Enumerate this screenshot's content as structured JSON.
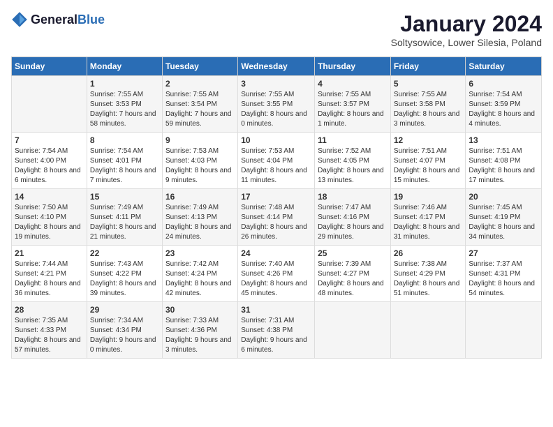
{
  "header": {
    "logo_general": "General",
    "logo_blue": "Blue",
    "month_title": "January 2024",
    "location": "Soltysowice, Lower Silesia, Poland"
  },
  "days_of_week": [
    "Sunday",
    "Monday",
    "Tuesday",
    "Wednesday",
    "Thursday",
    "Friday",
    "Saturday"
  ],
  "weeks": [
    [
      {
        "day": "",
        "info": ""
      },
      {
        "day": "1",
        "info": "Sunrise: 7:55 AM\nSunset: 3:53 PM\nDaylight: 7 hours\nand 58 minutes."
      },
      {
        "day": "2",
        "info": "Sunrise: 7:55 AM\nSunset: 3:54 PM\nDaylight: 7 hours\nand 59 minutes."
      },
      {
        "day": "3",
        "info": "Sunrise: 7:55 AM\nSunset: 3:55 PM\nDaylight: 8 hours\nand 0 minutes."
      },
      {
        "day": "4",
        "info": "Sunrise: 7:55 AM\nSunset: 3:57 PM\nDaylight: 8 hours\nand 1 minute."
      },
      {
        "day": "5",
        "info": "Sunrise: 7:55 AM\nSunset: 3:58 PM\nDaylight: 8 hours\nand 3 minutes."
      },
      {
        "day": "6",
        "info": "Sunrise: 7:54 AM\nSunset: 3:59 PM\nDaylight: 8 hours\nand 4 minutes."
      }
    ],
    [
      {
        "day": "7",
        "info": "Sunrise: 7:54 AM\nSunset: 4:00 PM\nDaylight: 8 hours\nand 6 minutes."
      },
      {
        "day": "8",
        "info": "Sunrise: 7:54 AM\nSunset: 4:01 PM\nDaylight: 8 hours\nand 7 minutes."
      },
      {
        "day": "9",
        "info": "Sunrise: 7:53 AM\nSunset: 4:03 PM\nDaylight: 8 hours\nand 9 minutes."
      },
      {
        "day": "10",
        "info": "Sunrise: 7:53 AM\nSunset: 4:04 PM\nDaylight: 8 hours\nand 11 minutes."
      },
      {
        "day": "11",
        "info": "Sunrise: 7:52 AM\nSunset: 4:05 PM\nDaylight: 8 hours\nand 13 minutes."
      },
      {
        "day": "12",
        "info": "Sunrise: 7:51 AM\nSunset: 4:07 PM\nDaylight: 8 hours\nand 15 minutes."
      },
      {
        "day": "13",
        "info": "Sunrise: 7:51 AM\nSunset: 4:08 PM\nDaylight: 8 hours\nand 17 minutes."
      }
    ],
    [
      {
        "day": "14",
        "info": "Sunrise: 7:50 AM\nSunset: 4:10 PM\nDaylight: 8 hours\nand 19 minutes."
      },
      {
        "day": "15",
        "info": "Sunrise: 7:49 AM\nSunset: 4:11 PM\nDaylight: 8 hours\nand 21 minutes."
      },
      {
        "day": "16",
        "info": "Sunrise: 7:49 AM\nSunset: 4:13 PM\nDaylight: 8 hours\nand 24 minutes."
      },
      {
        "day": "17",
        "info": "Sunrise: 7:48 AM\nSunset: 4:14 PM\nDaylight: 8 hours\nand 26 minutes."
      },
      {
        "day": "18",
        "info": "Sunrise: 7:47 AM\nSunset: 4:16 PM\nDaylight: 8 hours\nand 29 minutes."
      },
      {
        "day": "19",
        "info": "Sunrise: 7:46 AM\nSunset: 4:17 PM\nDaylight: 8 hours\nand 31 minutes."
      },
      {
        "day": "20",
        "info": "Sunrise: 7:45 AM\nSunset: 4:19 PM\nDaylight: 8 hours\nand 34 minutes."
      }
    ],
    [
      {
        "day": "21",
        "info": "Sunrise: 7:44 AM\nSunset: 4:21 PM\nDaylight: 8 hours\nand 36 minutes."
      },
      {
        "day": "22",
        "info": "Sunrise: 7:43 AM\nSunset: 4:22 PM\nDaylight: 8 hours\nand 39 minutes."
      },
      {
        "day": "23",
        "info": "Sunrise: 7:42 AM\nSunset: 4:24 PM\nDaylight: 8 hours\nand 42 minutes."
      },
      {
        "day": "24",
        "info": "Sunrise: 7:40 AM\nSunset: 4:26 PM\nDaylight: 8 hours\nand 45 minutes."
      },
      {
        "day": "25",
        "info": "Sunrise: 7:39 AM\nSunset: 4:27 PM\nDaylight: 8 hours\nand 48 minutes."
      },
      {
        "day": "26",
        "info": "Sunrise: 7:38 AM\nSunset: 4:29 PM\nDaylight: 8 hours\nand 51 minutes."
      },
      {
        "day": "27",
        "info": "Sunrise: 7:37 AM\nSunset: 4:31 PM\nDaylight: 8 hours\nand 54 minutes."
      }
    ],
    [
      {
        "day": "28",
        "info": "Sunrise: 7:35 AM\nSunset: 4:33 PM\nDaylight: 8 hours\nand 57 minutes."
      },
      {
        "day": "29",
        "info": "Sunrise: 7:34 AM\nSunset: 4:34 PM\nDaylight: 9 hours\nand 0 minutes."
      },
      {
        "day": "30",
        "info": "Sunrise: 7:33 AM\nSunset: 4:36 PM\nDaylight: 9 hours\nand 3 minutes."
      },
      {
        "day": "31",
        "info": "Sunrise: 7:31 AM\nSunset: 4:38 PM\nDaylight: 9 hours\nand 6 minutes."
      },
      {
        "day": "",
        "info": ""
      },
      {
        "day": "",
        "info": ""
      },
      {
        "day": "",
        "info": ""
      }
    ]
  ]
}
